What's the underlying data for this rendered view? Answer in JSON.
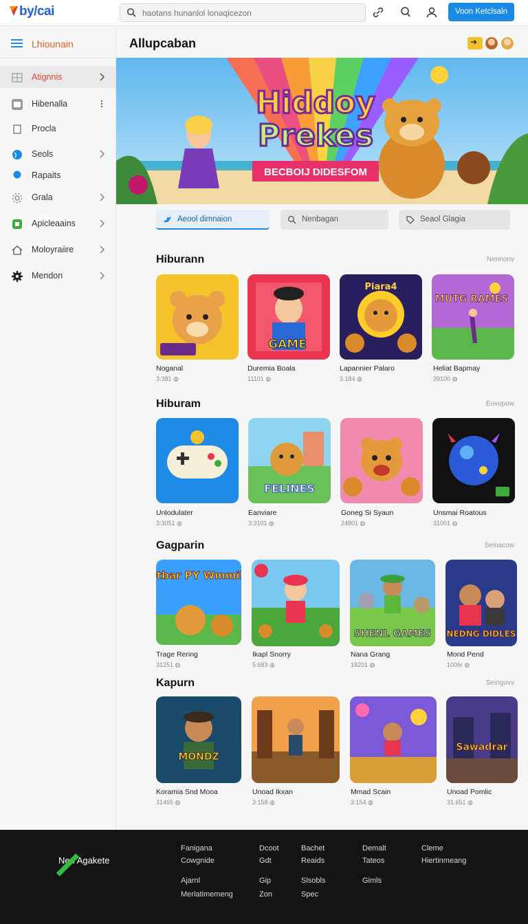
{
  "header": {
    "logo": "by/cai",
    "search_placeholder": "haotans hunanlol lonaqicezon",
    "cta_label": "Voon Ketclsaln"
  },
  "sidebar": {
    "title": "Lhiounain",
    "items": [
      {
        "label": "Atignnis",
        "icon": "grid-icon",
        "chevron": true,
        "active": true
      },
      {
        "label": "Hibenalla",
        "icon": "gallery-icon",
        "more": true
      },
      {
        "label": "Procla",
        "icon": "page-icon"
      },
      {
        "label": "Seols",
        "icon": "globe-icon",
        "chevron": true
      },
      {
        "label": "Rapaits",
        "icon": "dot-icon"
      },
      {
        "label": "Grala",
        "icon": "cog-outline-icon",
        "chevron": true
      },
      {
        "label": "Apicleaains",
        "icon": "android-icon",
        "chevron": true
      },
      {
        "label": "Moloyraiire",
        "icon": "home-icon",
        "chevron": true
      },
      {
        "label": "Mendon",
        "icon": "gear-icon",
        "chevron": true
      }
    ]
  },
  "main": {
    "title": "Allupcaban",
    "banner": {
      "headline_1": "Hiddoy",
      "headline_2": "Prekes",
      "ribbon": "BECBOIJ DIDESFOM"
    },
    "filters": [
      {
        "label": "Aeool dimnaion",
        "icon": "twitter-icon",
        "active": true
      },
      {
        "label": "Nenbagan",
        "icon": "search-icon"
      },
      {
        "label": "Seaol Glagia",
        "icon": "tag-icon"
      }
    ],
    "sections": [
      {
        "title": "Hiburann",
        "more": "Nennonv",
        "items": [
          {
            "name": "Noganal",
            "meta": "3:381 ◍"
          },
          {
            "name": "Duremia Boala",
            "meta": "11101 ◍"
          },
          {
            "name": "Lapannier Palaro",
            "meta": "3.184 ◍"
          },
          {
            "name": "Heliat Bapmay",
            "meta": "39100 ◍"
          }
        ]
      },
      {
        "title": "Hiburam",
        "more": "Eovopow",
        "items": [
          {
            "name": "Unlodulater",
            "meta": "3:3051 ◍"
          },
          {
            "name": "Eanviare",
            "meta": "3:3101 ◍"
          },
          {
            "name": "Goneg Si Syaun",
            "meta": "24801 ◍"
          },
          {
            "name": "Unsmai Roatous",
            "meta": "31001 ◍"
          }
        ]
      },
      {
        "title": "Gagparin",
        "more": "Seinacow",
        "items": [
          {
            "name": "Trage Rering",
            "meta": "31251 ◍"
          },
          {
            "name": "Ikapl Snorry",
            "meta": "5:683 ◍"
          },
          {
            "name": "Nana Grang",
            "meta": "18201 ◍"
          },
          {
            "name": "Mond Pend",
            "meta": "1006r ◍"
          }
        ]
      },
      {
        "title": "Kapurn",
        "more": "Seingovv",
        "items": [
          {
            "name": "Koramia Snd Mooa",
            "meta": "31465 ◍"
          },
          {
            "name": "Unoad Ikxan",
            "meta": "3:158 ◍"
          },
          {
            "name": "Mmad Scain",
            "meta": "3:154 ◍"
          },
          {
            "name": "Unoad Pomlic",
            "meta": "31.651 ◍"
          }
        ]
      }
    ],
    "tile_texts": [
      "GAME",
      "Piara4",
      "MUTG RAMES",
      "FELINES",
      "Dotbar PY Wmmiles",
      "SHENL GAMES",
      "NEDNG DIDLES",
      "MONDZ",
      "Sawadrar"
    ]
  },
  "footer": {
    "brand": "Nen  Agakete",
    "columns": [
      [
        "Fanigana",
        "Cowgnide",
        "Ajarnl",
        "Merlatimemeng"
      ],
      [
        "Dcoot",
        "Gdt",
        "Gip",
        "Zon"
      ],
      [
        "Bachet",
        "Reaids",
        "Slsobls",
        "Spec"
      ],
      [
        "Demalt",
        "Tateos",
        "Gimls"
      ],
      [
        "Cleme",
        "Hiertinmeang"
      ]
    ]
  },
  "colors": {
    "accent": "#1a8ae6",
    "active_text": "#e0442c",
    "footer_bg": "#141414"
  }
}
